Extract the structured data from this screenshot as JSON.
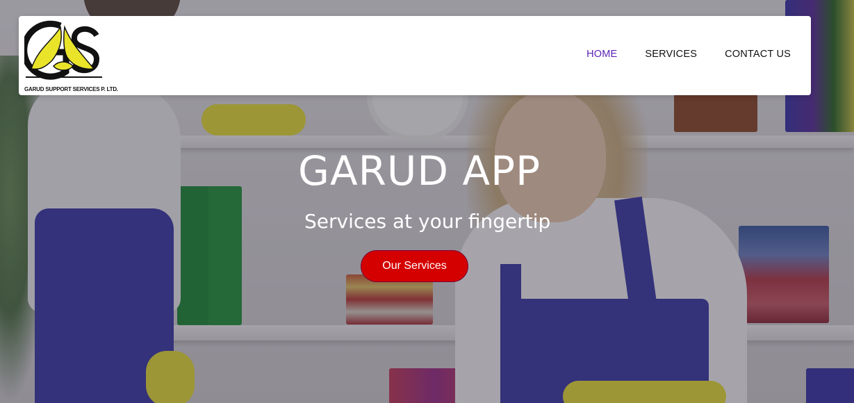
{
  "brand": {
    "logo_caption": "GARUD SUPPORT SERVICES P. LTD.",
    "logo_icon": "garud-eagle-logo",
    "logo_colors": {
      "primary": "#111111",
      "accent": "#e9e42a"
    }
  },
  "nav": {
    "items": [
      {
        "label": "HOME",
        "active": true
      },
      {
        "label": "SERVICES",
        "active": false
      },
      {
        "label": "CONTACT US",
        "active": false
      }
    ],
    "active_color": "#5a1fb5"
  },
  "hero": {
    "title": "GARUD APP",
    "subtitle": "Services at your fingertip",
    "cta_label": "Our Services",
    "cta_color": "#d40000"
  }
}
